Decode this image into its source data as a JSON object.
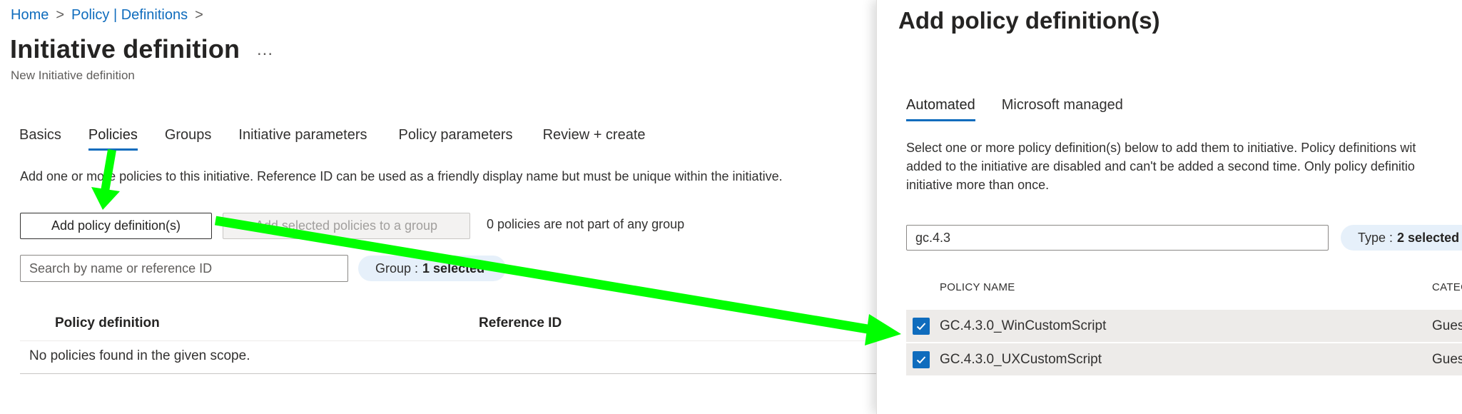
{
  "breadcrumb": {
    "home": "Home",
    "policy": "Policy | Definitions",
    "sep": ">"
  },
  "page": {
    "title": "Initiative definition",
    "ellipsis": "...",
    "subtitle": "New Initiative definition"
  },
  "tabs": [
    "Basics",
    "Policies",
    "Groups",
    "Initiative parameters",
    "Policy parameters",
    "Review + create"
  ],
  "active_tab": "Policies",
  "policies": {
    "description": "Add one or more policies to this initiative. Reference ID can be used as a friendly display name but must be unique within the initiative.",
    "add_button": "Add policy definition(s)",
    "group_button": "Add selected policies to a group",
    "group_note": "0 policies are not part of any group",
    "search_placeholder": "Search by name or reference ID",
    "filter": {
      "label": "Group : ",
      "value": "1 selected"
    },
    "columns": [
      "Policy definition",
      "Reference ID"
    ],
    "empty_text": "No policies found in the given scope."
  },
  "panel": {
    "title": "Add policy definition(s)",
    "tabs": [
      "Automated",
      "Microsoft managed"
    ],
    "active_tab": "Automated",
    "description_lines": [
      "Select one or more policy definition(s) below to add them to initiative. Policy definitions wit",
      "added to the initiative are disabled and can't be added a second time. Only policy definitio",
      "initiative more than once."
    ],
    "search_value": "gc.4.3",
    "type_filter": {
      "label": "Type : ",
      "value": "2 selected"
    },
    "columns": [
      "POLICY NAME",
      "CATEG"
    ],
    "rows": [
      {
        "name": "GC.4.3.0_WinCustomScript",
        "category": "Gues",
        "checked": true
      },
      {
        "name": "GC.4.3.0_UXCustomScript",
        "category": "Gues",
        "checked": true
      }
    ]
  },
  "colors": {
    "accent": "#0f6cbd",
    "arrow": "#00ff00",
    "pill": "#e6f0fa",
    "row_selected": "#edebe9"
  },
  "icons": [
    "chevron-right-icon",
    "more-icon",
    "checkbox-checked-icon",
    "green-arrow-annotation"
  ]
}
